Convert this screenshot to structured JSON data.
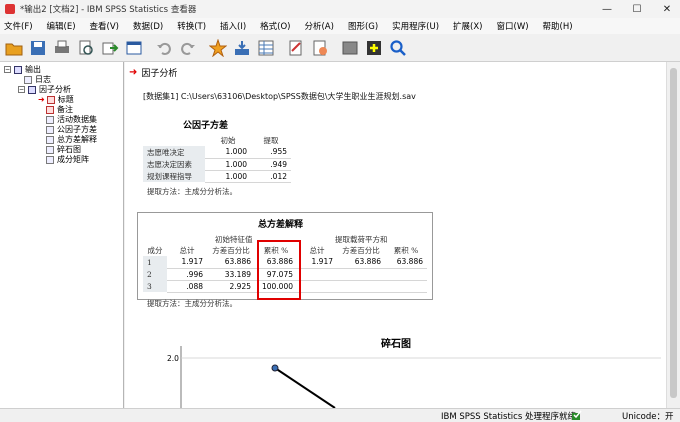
{
  "window": {
    "title": "*输出2 [文档2] - IBM SPSS Statistics 查看器",
    "minimize": "—",
    "maximize": "☐",
    "close": "✕"
  },
  "menu": [
    "文件(F)",
    "编辑(E)",
    "查看(V)",
    "数据(D)",
    "转换(T)",
    "插入(I)",
    "格式(O)",
    "分析(A)",
    "图形(G)",
    "实用程序(U)",
    "扩展(X)",
    "窗口(W)",
    "帮助(H)"
  ],
  "toolbar_icons": [
    "open-folder-icon",
    "save-icon",
    "print-icon",
    "print-preview-icon",
    "export-icon",
    "recall-dialog-icon",
    "undo-icon",
    "redo-icon",
    "goto-data-icon",
    "goto-case-icon",
    "variables-icon",
    "insert-heading-icon",
    "insert-title-icon",
    "insert-text-icon",
    "show-all-icon",
    "designate-window-icon",
    "search-icon"
  ],
  "outline": {
    "root": "输出",
    "log": "日志",
    "group": "因子分析",
    "items": [
      "标题",
      "备注",
      "活动数据集",
      "公因子方差",
      "总方差解释",
      "碎石图",
      "成分矩阵"
    ]
  },
  "content": {
    "section_title": "因子分析",
    "dataset_line": "[数据集1] C:\\Users\\63106\\Desktop\\SPSS数据包\\大学生职业生涯规划.sav"
  },
  "communalities": {
    "title": "公因子方差",
    "headers": [
      "初始",
      "提取"
    ],
    "rows": [
      {
        "label": "志愿唯决定",
        "initial": "1.000",
        "extract": ".955"
      },
      {
        "label": "志愿决定因素",
        "initial": "1.000",
        "extract": ".949"
      },
      {
        "label": "规划课程指导",
        "initial": "1.000",
        "extract": ".012"
      }
    ],
    "footnote": "提取方法：主成分分析法。"
  },
  "variance": {
    "title": "总方差解释",
    "group1": "初始特征值",
    "group2": "提取载荷平方和",
    "col_component": "成分",
    "col_total": "总计",
    "col_pct": "方差百分比",
    "col_cum": "累积 %",
    "rows": [
      {
        "c": "1",
        "t": "1.917",
        "p": "63.886",
        "cum": "63.886",
        "et": "1.917",
        "ep": "63.886",
        "ecum": "63.886"
      },
      {
        "c": "2",
        "t": ".996",
        "p": "33.189",
        "cum": "97.075",
        "et": "",
        "ep": "",
        "ecum": ""
      },
      {
        "c": "3",
        "t": ".088",
        "p": "2.925",
        "cum": "100.000",
        "et": "",
        "ep": "",
        "ecum": ""
      }
    ],
    "footnote": "提取方法：主成分分析法。"
  },
  "scree": {
    "title": "碎石图",
    "ytick": "2.0"
  },
  "status": {
    "main": "IBM SPSS Statistics 处理程序就绪",
    "unicode": "Unicode：开"
  },
  "colors": {
    "accent_red": "#e00000",
    "row_label_bg": "#e8ecef"
  }
}
